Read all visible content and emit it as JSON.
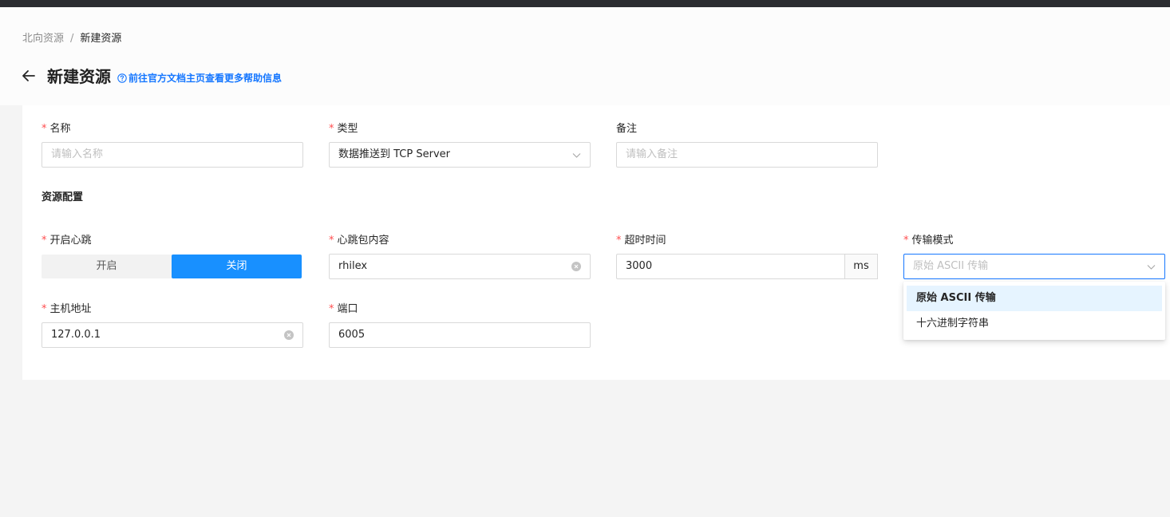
{
  "breadcrumb": {
    "parent": "北向资源",
    "separator": "/",
    "current": "新建资源"
  },
  "header": {
    "title": "新建资源",
    "help_link": "前往官方文档主页查看更多帮助信息"
  },
  "basic": {
    "name": {
      "label": "名称",
      "placeholder": "请输入名称"
    },
    "type": {
      "label": "类型",
      "value": "数据推送到 TCP Server"
    },
    "remark": {
      "label": "备注",
      "placeholder": "请输入备注"
    }
  },
  "config": {
    "section_title": "资源配置",
    "heartbeat": {
      "label": "开启心跳",
      "options": [
        "开启",
        "关闭"
      ],
      "selected": "关闭"
    },
    "heartbeat_content": {
      "label": "心跳包内容",
      "value": "rhilex"
    },
    "timeout": {
      "label": "超时时间",
      "value": "3000",
      "unit": "ms"
    },
    "transfer_mode": {
      "label": "传输模式",
      "placeholder": "原始 ASCII 传输",
      "options": [
        "原始 ASCII 传输",
        "十六进制字符串"
      ],
      "highlighted": "原始 ASCII 传输"
    },
    "host": {
      "label": "主机地址",
      "value": "127.0.0.1"
    },
    "port": {
      "label": "端口",
      "value": "6005"
    }
  },
  "required_mark": "*",
  "icons": {
    "back": "arrow-left-icon",
    "help": "question-circle-icon",
    "clear": "close-circle-icon",
    "select": "chevron-down-icon"
  },
  "colors": {
    "primary": "#1890ff",
    "required": "#ff4d4f",
    "link": "#1677ff"
  }
}
